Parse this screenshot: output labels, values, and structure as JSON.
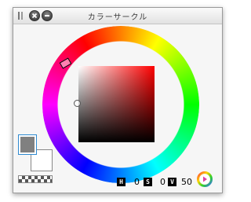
{
  "window": {
    "title": "カラーサークル"
  },
  "titlebar_icons": [
    "grip-icon",
    "close-icon",
    "minimize-icon"
  ],
  "colors": {
    "main": "#808080",
    "sub": "#ffffff",
    "hue_marker": "#ff2a2a"
  },
  "hsv": {
    "h_label": "H",
    "h_value": "0",
    "s_label": "S",
    "s_value": "0",
    "v_label": "V",
    "v_value": "50"
  },
  "menu_icon": "color-wheel-menu-icon"
}
